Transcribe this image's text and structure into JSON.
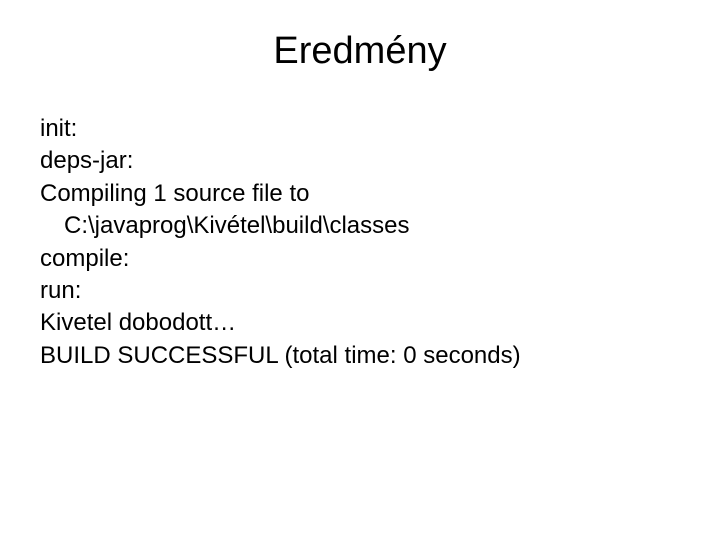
{
  "title": "Eredmény",
  "lines": {
    "l1": "init:",
    "l2": "deps-jar:",
    "l3": "Compiling 1 source file to",
    "l4": "C:\\javaprog\\Kivétel\\build\\classes",
    "l5": "compile:",
    "l6": "run:",
    "l7": "Kivetel dobodott…",
    "l8": "BUILD SUCCESSFUL (total time: 0 seconds)"
  }
}
